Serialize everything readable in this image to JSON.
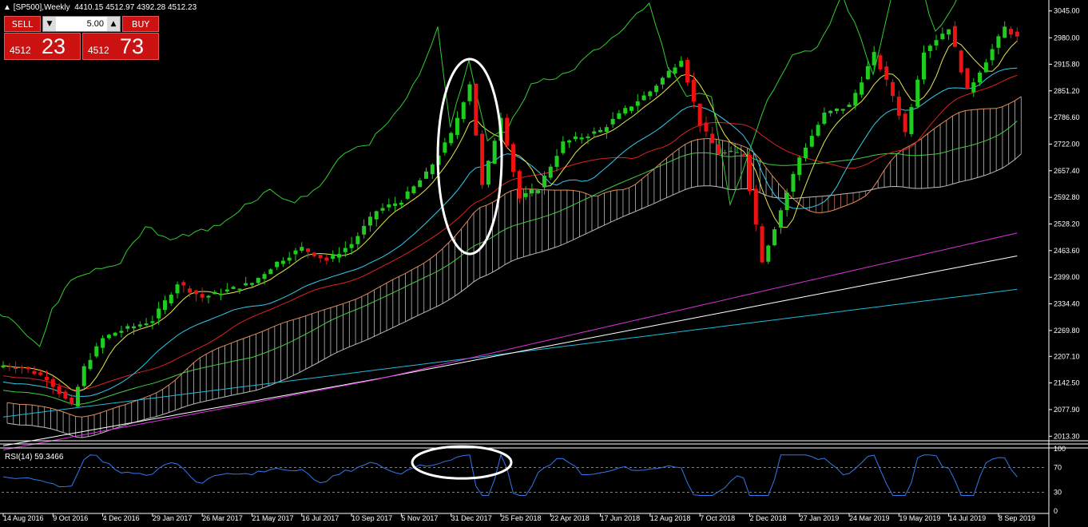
{
  "header": {
    "symbol": "[SP500],Weekly",
    "ohlc": "4410.15 4512.97 4392.28 4512.23"
  },
  "trade_panel": {
    "sell_label": "SELL",
    "buy_label": "BUY",
    "lot_value": "5.00",
    "sell_price_small": "4512",
    "sell_price_big": "23",
    "buy_price_small": "4512",
    "buy_price_big": "73"
  },
  "rsi": {
    "label": "RSI(14) 59.3466"
  },
  "colors": {
    "background": "#000000",
    "bull": "#1fcc1f",
    "bear": "#ee1111",
    "tenkan": "#e6e64d",
    "kijun": "#33ccee",
    "chikou": "#33cc33",
    "ma_red": "#dd2222",
    "ma_green": "#44cc44",
    "ma_magenta": "#dd33dd",
    "ma_white": "#ffffff",
    "ma_cyan": "#22bbdd",
    "rsi_line": "#3377ee",
    "annotation": "#ffffff"
  },
  "chart_data": [
    {
      "type": "candlestick",
      "timeframe": "Weekly",
      "y_ticks": [
        "3045.00",
        "2980.00",
        "2915.80",
        "2851.20",
        "2786.60",
        "2722.00",
        "2657.40",
        "2592.80",
        "2528.20",
        "2463.60",
        "2399.00",
        "2334.40",
        "2269.80",
        "2207.10",
        "2142.50",
        "2077.90",
        "2013.30"
      ],
      "ylim": [
        2010,
        3060
      ],
      "x_tick_labels": [
        "14 Aug 2016",
        "9 Oct 2016",
        "4 Dec 2016",
        "29 Jan 2017",
        "26 Mar 2017",
        "21 May 2017",
        "16 Jul 2017",
        "10 Sep 2017",
        "5 Nov 2017",
        "31 Dec 2017",
        "25 Feb 2018",
        "22 Apr 2018",
        "17 Jun 2018",
        "12 Aug 2018",
        "7 Oct 2018",
        "2 Dec 2018",
        "27 Jan 2019",
        "24 Mar 2019",
        "19 May 2019",
        "14 Jul 2019",
        "8 Sep 2019"
      ],
      "weekly_close_path": [
        [
          "2016-08-14",
          2185
        ],
        [
          "2016-09-04",
          2180
        ],
        [
          "2016-10-02",
          2155
        ],
        [
          "2016-10-30",
          2085
        ],
        [
          "2016-11-13",
          2180
        ],
        [
          "2016-12-04",
          2250
        ],
        [
          "2016-12-18",
          2265
        ],
        [
          "2017-01-29",
          2295
        ],
        [
          "2017-02-26",
          2385
        ],
        [
          "2017-03-26",
          2350
        ],
        [
          "2017-05-21",
          2385
        ],
        [
          "2017-06-18",
          2435
        ],
        [
          "2017-07-16",
          2470
        ],
        [
          "2017-08-13",
          2440
        ],
        [
          "2017-09-10",
          2480
        ],
        [
          "2017-10-08",
          2560
        ],
        [
          "2017-11-05",
          2585
        ],
        [
          "2017-12-03",
          2650
        ],
        [
          "2017-12-31",
          2745
        ],
        [
          "2018-01-21",
          2870
        ],
        [
          "2018-02-04",
          2620
        ],
        [
          "2018-02-25",
          2790
        ],
        [
          "2018-03-18",
          2590
        ],
        [
          "2018-04-08",
          2615
        ],
        [
          "2018-05-06",
          2725
        ],
        [
          "2018-06-17",
          2755
        ],
        [
          "2018-07-15",
          2805
        ],
        [
          "2018-08-12",
          2850
        ],
        [
          "2018-09-16",
          2930
        ],
        [
          "2018-10-07",
          2770
        ],
        [
          "2018-10-28",
          2700
        ],
        [
          "2018-11-25",
          2700
        ],
        [
          "2018-12-16",
          2440
        ],
        [
          "2018-12-30",
          2520
        ],
        [
          "2019-01-27",
          2690
        ],
        [
          "2019-02-24",
          2795
        ],
        [
          "2019-03-24",
          2815
        ],
        [
          "2019-04-21",
          2940
        ],
        [
          "2019-05-12",
          2840
        ],
        [
          "2019-05-26",
          2750
        ],
        [
          "2019-06-16",
          2950
        ],
        [
          "2019-07-14",
          3005
        ],
        [
          "2019-08-04",
          2850
        ],
        [
          "2019-08-25",
          2925
        ],
        [
          "2019-09-15",
          3005
        ],
        [
          "2019-09-29",
          2980
        ]
      ],
      "series": [
        {
          "name": "",
          "kind": "tenkan-sen"
        },
        {
          "name": "",
          "kind": "kijun-sen"
        },
        {
          "name": "",
          "kind": "chikou span"
        },
        {
          "name": "",
          "kind": "senkou span cloud"
        },
        {
          "name": "",
          "kind": "moving average"
        }
      ],
      "annotations": [
        "ellipse around top near 31 Dec 2017 - 25 Feb 2018"
      ]
    },
    {
      "type": "line",
      "title": "RSI(14) 59.3466",
      "y_ticks": [
        "100",
        "70",
        "30",
        "0"
      ],
      "ylim": [
        0,
        100
      ],
      "levels": [
        70,
        30
      ],
      "current": 59.3466,
      "annotations": [
        "ellipse around RSI peak near 31 Dec 2017"
      ]
    }
  ]
}
